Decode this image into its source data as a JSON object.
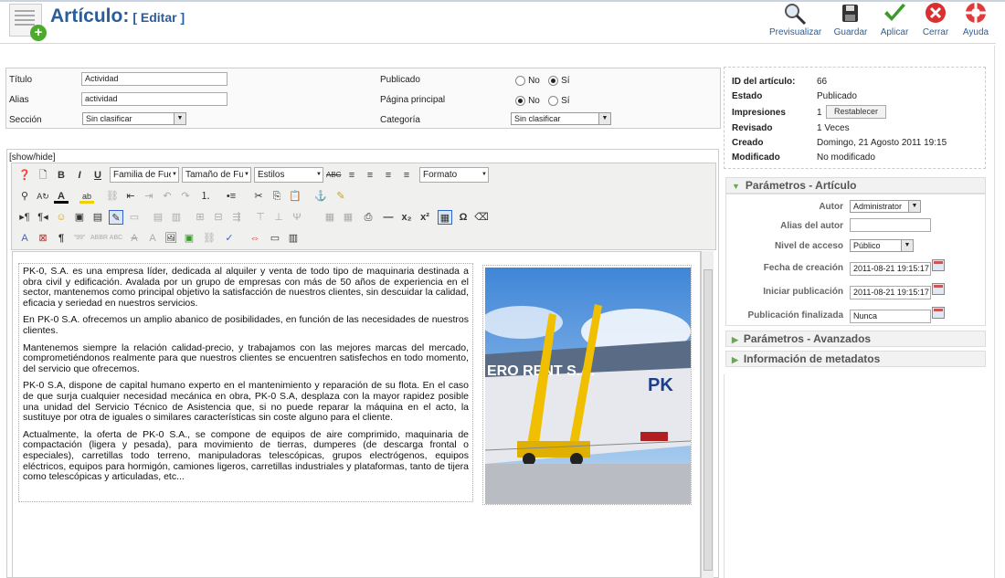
{
  "header": {
    "title": "Artículo:",
    "subtitle": "[ Editar ]",
    "toolbar": [
      {
        "label": "Previsualizar",
        "icon": "preview-icon"
      },
      {
        "label": "Guardar",
        "icon": "save-icon"
      },
      {
        "label": "Aplicar",
        "icon": "apply-icon"
      },
      {
        "label": "Cerrar",
        "icon": "close-icon"
      },
      {
        "label": "Ayuda",
        "icon": "help-icon"
      }
    ]
  },
  "form": {
    "titulo_label": "Título",
    "titulo_value": "Actividad",
    "alias_label": "Alias",
    "alias_value": "actividad",
    "seccion_label": "Sección",
    "seccion_value": "Sin clasificar",
    "publicado_label": "Publicado",
    "pagina_label": "Página principal",
    "categoria_label": "Categoría",
    "categoria_value": "Sin clasificar",
    "no": "No",
    "si": "Sí",
    "publicado_selected": "Sí",
    "pagina_selected": "No"
  },
  "editor": {
    "showhide": "[show/hide]",
    "font_family": "Familia de Fuen",
    "font_size": "Tamaño de Fue",
    "styles": "Estilos",
    "format": "Formato",
    "paragraphs": [
      "PK-0, S.A. es una empresa líder, dedicada al alquiler y venta de todo tipo de maquinaria destinada a obra civil y edificación. Avalada por un grupo de empresas con más de 50 años de experiencia en el sector, mantenemos como principal objetivo la satisfacción de nuestros clientes, sin descuidar la calidad, eficacia y seriedad en nuestros servicios.",
      "En PK-0 S.A. ofrecemos un amplio abanico de posibilidades, en función de las necesidades de nuestros clientes.",
      "Mantenemos siempre la relación calidad-precio, y trabajamos con las mejores marcas del mercado, comprometiéndonos realmente para que nuestros clientes se encuentren satisfechos en todo momento, del servicio que ofrecemos.",
      "PK-0 S.A, dispone de capital humano experto en el mantenimiento y reparación de su flota. En el caso de que surja cualquier necesidad mecánica en obra, PK-0 S.A, desplaza con la mayor rapidez posible una unidad del Servicio Técnico de Asistencia que, si no puede reparar la máquina en el acto, la sustituye por otra de iguales o similares características sin coste alguno para el cliente.",
      "Actualmente, la oferta de PK-0 S.A., se compone de equipos de aire comprimido, maquinaria de compactación (ligera y pesada), para movimiento de tierras, dumperes (de descarga frontal o especiales), carretillas todo terreno, manipuladoras telescópicas, grupos electrógenos, equipos eléctricos, equipos para hormigón, camiones ligeros, carretillas industriales y plataformas, tanto de tijera como telescópicas y articuladas, etc..."
    ],
    "photo_sign": "ERO RENT S.A.",
    "photo_logo": "PK"
  },
  "details": {
    "id_label": "ID del artículo:",
    "id_value": "66",
    "estado_label": "Estado",
    "estado_value": "Publicado",
    "impresiones_label": "Impresiones",
    "impresiones_value": "1",
    "reset_label": "Restablecer",
    "revisado_label": "Revisado",
    "revisado_value": "1 Veces",
    "creado_label": "Creado",
    "creado_value": "Domingo, 21 Agosto 2011 19:15",
    "modificado_label": "Modificado",
    "modificado_value": "No modificado"
  },
  "params": {
    "header": "Parámetros - Artículo",
    "autor_label": "Autor",
    "autor_value": "Administrator",
    "alias_autor_label": "Alias del autor",
    "alias_autor_value": "",
    "nivel_label": "Nivel de acceso",
    "nivel_value": "Público",
    "fecha_label": "Fecha de creación",
    "fecha_value": "2011-08-21 19:15:17",
    "iniciar_label": "Iniciar publicación",
    "iniciar_value": "2011-08-21 19:15:17",
    "fin_label": "Publicación finalizada",
    "fin_value": "Nunca"
  },
  "accordion": {
    "avanzados": "Parámetros - Avanzados",
    "metadatos": "Información de metadatos"
  },
  "colors": {
    "accent": "#2a5d9c",
    "header_green": "#6aa84f"
  }
}
